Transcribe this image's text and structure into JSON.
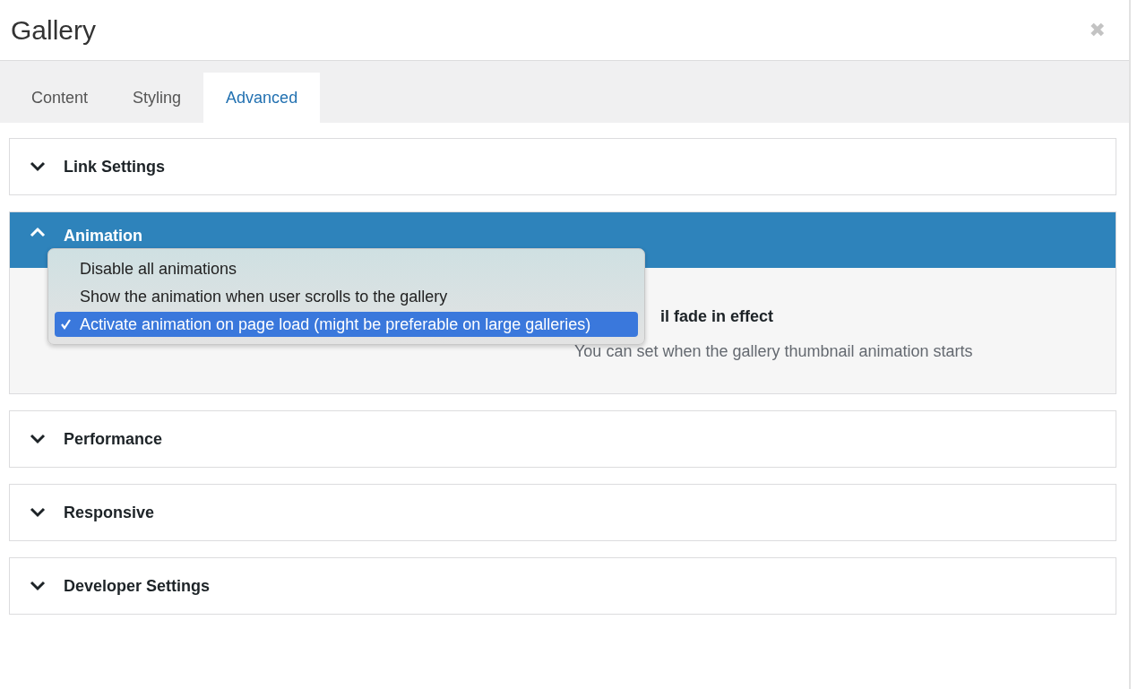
{
  "window": {
    "title": "Gallery",
    "close": "✖"
  },
  "tabs": [
    {
      "label": "Content",
      "selected": false
    },
    {
      "label": "Styling",
      "selected": false
    },
    {
      "label": "Advanced",
      "selected": true
    }
  ],
  "sections": [
    {
      "title": "Link Settings",
      "expanded": false
    },
    {
      "title": "Animation",
      "expanded": true,
      "field": {
        "label": "il fade in effect",
        "description": "You can set when the gallery thumbnail animation starts"
      },
      "menu": [
        {
          "label": "Disable all animations",
          "selected": false
        },
        {
          "label": "Show the animation when user scrolls to the gallery",
          "selected": false
        },
        {
          "label": "Activate animation on page load (might be preferable on large galleries)",
          "selected": true
        }
      ]
    },
    {
      "title": "Performance",
      "expanded": false
    },
    {
      "title": "Responsive",
      "expanded": false
    },
    {
      "title": "Developer Settings",
      "expanded": false
    }
  ]
}
